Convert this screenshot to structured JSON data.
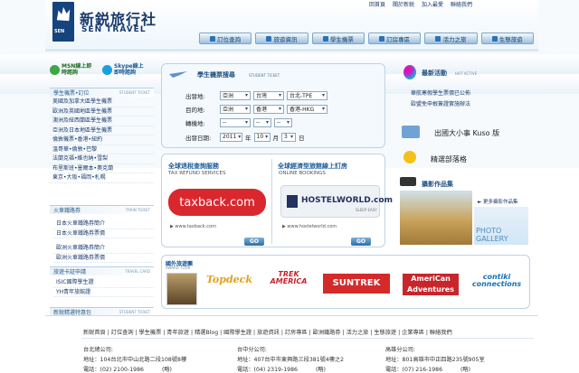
{
  "top_links": [
    "回首頁",
    "關於新鋭",
    "加入最愛",
    "聯絡我們"
  ],
  "brand": {
    "cn": "新鋭旅行社",
    "en": "SEN TRAVEL",
    "logo_small": "SEN"
  },
  "nav": [
    "訂位查詢",
    "旅遊資訊",
    "學生機票",
    "訂房專區",
    "活力之旅",
    "生態旅遊"
  ],
  "chat": {
    "msn": "MSN線上即時諮詢",
    "skype": "Skype線上即時諮詢"
  },
  "side": {
    "student_head": "學生機票•訂位",
    "student_en": "STUDENT TICKET",
    "student_items": [
      "美國及加拿大區學生機票",
      "歐洲及英國地區學生機票",
      "澳洲及紐西蘭區學生機票",
      "亞洲及日本地區學生機票",
      "倫敦機票•香港•紐約",
      "溫哥華•倫敦•巴黎",
      "法蘭克福•維也納•雪梨",
      "布里斯班•墨爾本•奧克蘭",
      "東京•大阪•福岡•札幌"
    ],
    "train_head": "火車鐵路券",
    "train_en": "TRAIN TICKET",
    "train_items": [
      "日本火車鐵路券簡介",
      "日本火車鐵路券票價",
      "歐洲火車鐵路券簡介",
      "歐洲火車鐵路券票價"
    ],
    "card_head": "旅遊卡証申請",
    "card_en": "TRAVEL CARD",
    "card_items": [
      "ISIC國際學生證",
      "YH青年旅館證"
    ],
    "bottom_head": "新鋭精選特惠包",
    "bottom_en": "STUDENT TICKET"
  },
  "search": {
    "title": "學生機票搜尋",
    "title_en": "STUDENT TICKET",
    "depart_label": "出發地:",
    "dest_label": "目的地:",
    "transfer_label": "轉機地:",
    "date_label": "出發日期:",
    "depart": [
      "亞洲",
      "台灣",
      "台北-TPE"
    ],
    "dest": [
      "亞洲",
      "香港",
      "香港-HKG"
    ],
    "transfer": [
      "--",
      "--",
      "--"
    ],
    "year": "2011",
    "year_unit": "年",
    "month": "10",
    "month_unit": "月",
    "day": "3",
    "day_unit": "日"
  },
  "promo": {
    "tax_title": "全球退稅查詢服務",
    "tax_en": "TAX REFUND SERVICES",
    "tax_logo": "taxback.com",
    "tax_url": "▶ www.taxback.com",
    "hostel_title": "全球經濟型旅館線上訂房",
    "hostel_en": "ONLINE BOOKINGS",
    "hostel_logo": "HOSTELWORLD.com",
    "hostel_sub": "SLEEP EASY",
    "hostel_url": "▶ www.hostelworld.com",
    "go": "GO"
  },
  "right": {
    "news_title": "最新活動",
    "news_en": "HOT ACTIVE",
    "news_items": [
      "華航寒假學生票價已公佈",
      "歐盟免申根簽證實施辦法"
    ],
    "kuso": "出國大小事 Kuso 版",
    "blog": "精選部落格",
    "photo_title": "攝影作品集",
    "photo_more": "► 更多攝影作品集",
    "photo_caption": "PHOTO GALLERY"
  },
  "partners": {
    "title": "國外旅遊團",
    "title_en": "AWARD TOUR",
    "logos": [
      "Topdeck",
      "TREK AMERICA",
      "SUNTREK",
      "AmeriCan Adventures",
      "contiki connections"
    ]
  },
  "footer_links": "新鋭首頁 | 訂位查詢 | 學生機票 | 青年旅遊 | 精選Blog | 國際學生證 | 旅遊資訊 | 訂房專區 | 歐洲鐵路券 | 活力之旅 | 生態旅遊 | 企業專區 | 聯絡我們",
  "offices": [
    {
      "name": "台北總公司:",
      "addr": "地址：104台北市中山北路二段108號8樓",
      "tel": "電話：(02) 2100-1986",
      "fax": "(略)"
    },
    {
      "name": "台中分公司:",
      "addr": "地址：407台中市東興路三段381號4樓之2",
      "tel": "電話：(04) 2319-1986",
      "fax": "(略)"
    },
    {
      "name": "高雄分公司:",
      "addr": "地址：801高雄市中正四路235號905室",
      "tel": "電話：(07) 216-1986",
      "fax": "(略)"
    }
  ]
}
